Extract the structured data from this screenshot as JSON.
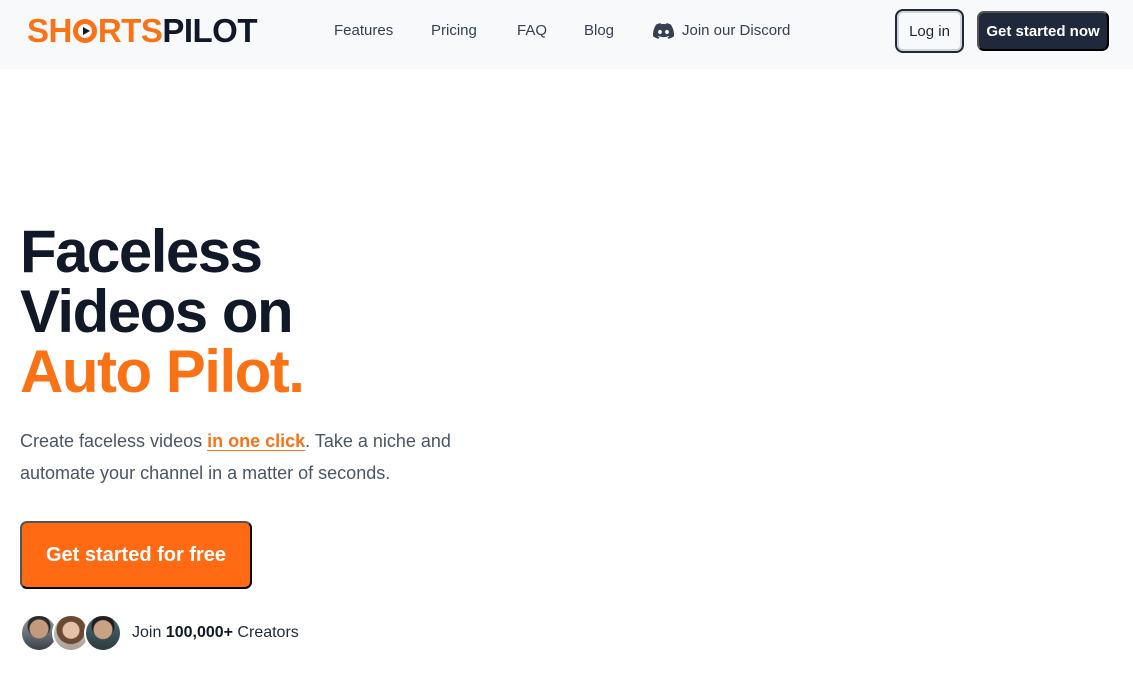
{
  "brand": {
    "logo_part1_pre": "SH",
    "logo_part1_post": "RTS",
    "logo_part2": "PILOT",
    "accent_color": "#f97316",
    "dark_color": "#1e293b"
  },
  "nav": {
    "features": "Features",
    "pricing": "Pricing",
    "faq": "FAQ",
    "blog": "Blog",
    "discord": "Join our Discord",
    "discord_icon": "discord-icon"
  },
  "header_actions": {
    "login": "Log in",
    "get_started": "Get started now"
  },
  "hero": {
    "title_line1": "Faceless",
    "title_line2": "Videos on",
    "title_accent": "Auto Pilot.",
    "sub_pre": "Create faceless videos ",
    "sub_highlight": "in one click",
    "sub_post": ". Take a niche and automate your channel in a matter of seconds.",
    "cta": "Get started for free"
  },
  "creators": {
    "pre": "Join ",
    "count": "100,000+",
    "post": " Creators"
  }
}
